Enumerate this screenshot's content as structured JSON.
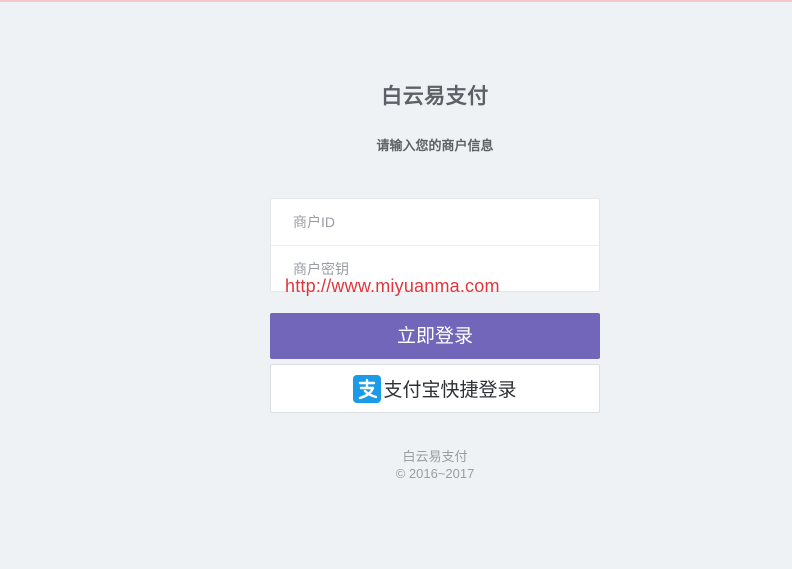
{
  "header": {
    "title": "白云易支付",
    "subtitle": "请输入您的商户信息"
  },
  "form": {
    "merchant_id": {
      "placeholder": "商户ID",
      "value": ""
    },
    "merchant_key": {
      "placeholder": "商户密钥",
      "value": ""
    }
  },
  "watermark": "http://www.miyuanma.com",
  "buttons": {
    "login_label": "立即登录",
    "alipay_label": "支付宝快捷登录"
  },
  "footer": {
    "name": "白云易支付",
    "copyright": "© 2016~2017"
  },
  "colors": {
    "accent": "#7266bb",
    "alipay_blue": "#1a9be8",
    "background": "#eff2f4",
    "watermark": "#e0363b"
  },
  "icons": {
    "alipay": "alipay-icon"
  }
}
